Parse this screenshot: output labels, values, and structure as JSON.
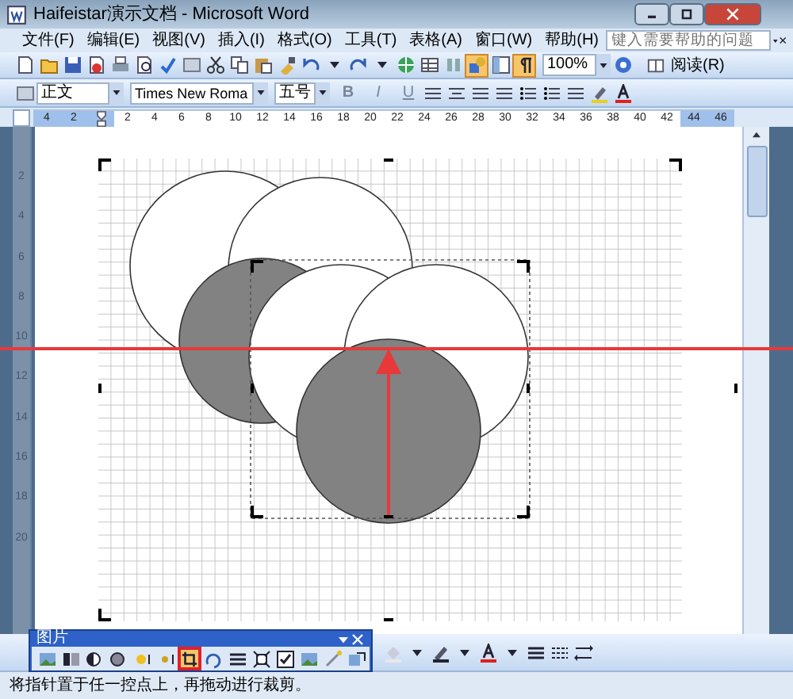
{
  "window": {
    "title": "Haifeistar演示文档 - Microsoft Word"
  },
  "menu": [
    "文件(F)",
    "编辑(E)",
    "视图(V)",
    "插入(I)",
    "格式(O)",
    "工具(T)",
    "表格(A)",
    "窗口(W)",
    "帮助(H)"
  ],
  "help_box": {
    "placeholder": "键入需要帮助的问题"
  },
  "standard_toolbar": {
    "toggles": [
      {
        "on": true
      },
      {
        "on": false
      },
      {
        "on": true
      }
    ],
    "zoom": "100%",
    "read_button": "阅读(R)"
  },
  "formatting_toolbar": {
    "style": "正文",
    "font": "Times New Roma",
    "size": "五号",
    "buttons": [
      "B",
      "I",
      "U"
    ]
  },
  "ruler": {
    "left_numbers": [
      "4",
      "2"
    ],
    "numbers": [
      "2",
      "4",
      "6",
      "8",
      "10",
      "12",
      "14",
      "16",
      "18",
      "20",
      "22",
      "24",
      "26",
      "28",
      "30",
      "32",
      "34",
      "36",
      "38",
      "40",
      "42"
    ],
    "right_numbers": [
      "44",
      "46"
    ]
  },
  "vertical_ruler": [
    "2",
    "4",
    "6",
    "8",
    "10",
    "12",
    "14",
    "16",
    "18",
    "20"
  ],
  "picture_toolbar": {
    "title": "图片",
    "tools": [
      {
        "selected": false
      },
      {
        "selected": false
      },
      {
        "selected": false
      },
      {
        "selected": false
      },
      {
        "selected": false
      },
      {
        "selected": false
      },
      {
        "selected": true
      },
      {
        "selected": false
      },
      {
        "selected": false
      },
      {
        "selected": false
      },
      {
        "selected": false
      },
      {
        "selected": false
      },
      {
        "selected": false
      },
      {
        "selected": false
      }
    ]
  },
  "status_bar": "将指针置于任一控点上，再拖动进行裁剪。"
}
